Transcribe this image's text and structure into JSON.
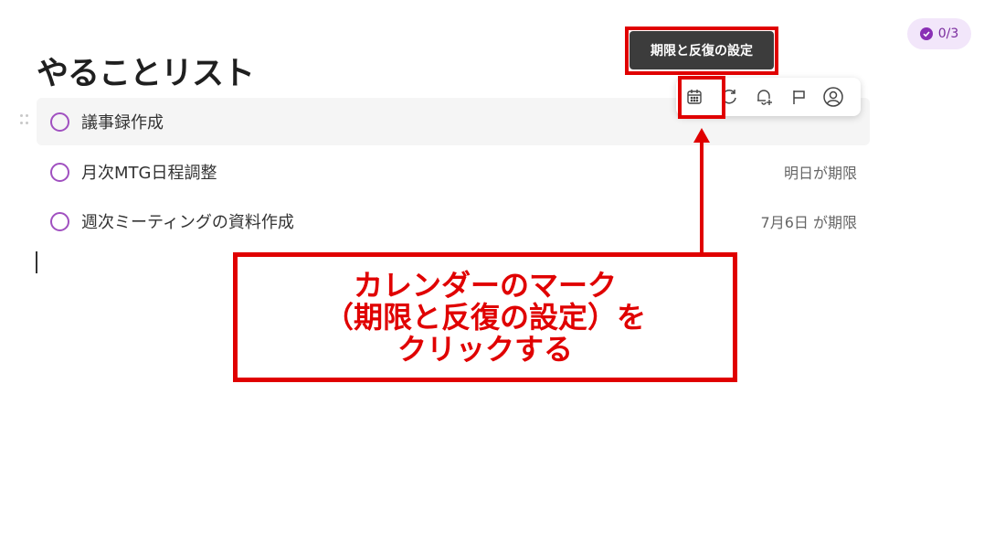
{
  "progress": {
    "label": "0/3",
    "completed": 0,
    "total": 3
  },
  "page_title": "やることリスト",
  "tasks": [
    {
      "text": "議事録作成",
      "due": ""
    },
    {
      "text": "月次MTG日程調整",
      "due": "明日が期限"
    },
    {
      "text": "週次ミーティングの資料作成",
      "due": "7月6日 が期限"
    }
  ],
  "toolbar": {
    "tooltip": "期限と反復の設定",
    "icons": [
      "calendar-icon",
      "repeat-icon",
      "reminder-bell-icon",
      "flag-icon",
      "assign-user-icon"
    ]
  },
  "annotation": {
    "line1": "カレンダーのマーク",
    "line2": "（期限と反復の設定）を",
    "line3": "クリックする"
  },
  "colors": {
    "accent": "#a050c0",
    "annotation_red": "#e00000",
    "tooltip_bg": "#3c3c3c"
  }
}
